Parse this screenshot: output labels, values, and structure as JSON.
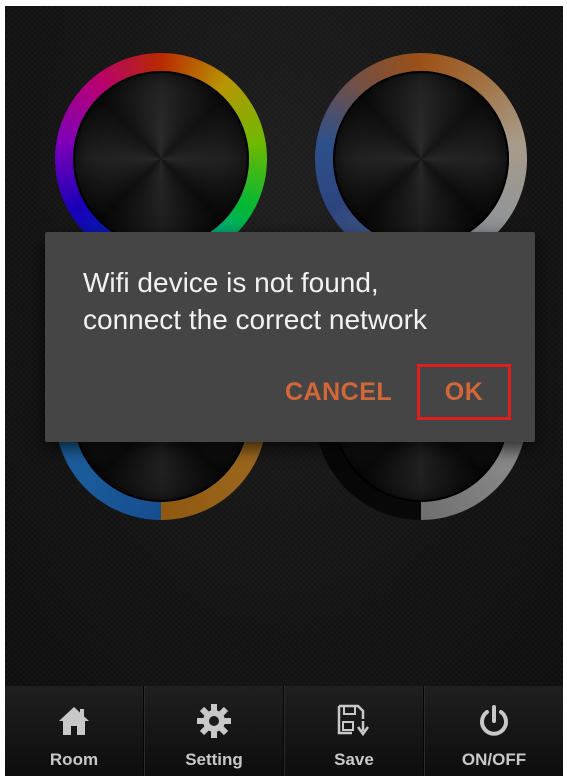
{
  "dialog": {
    "message_line1": "Wifi device is not found,",
    "message_line2": "connect the correct network",
    "cancel_label": "CANCEL",
    "ok_label": "OK"
  },
  "tabbar": {
    "items": [
      {
        "label": "Room",
        "icon": "home-icon"
      },
      {
        "label": "Setting",
        "icon": "gear-icon"
      },
      {
        "label": "Save",
        "icon": "save-icon"
      },
      {
        "label": "ON/OFF",
        "icon": "power-icon"
      }
    ]
  },
  "colors": {
    "accent": "#d4673a",
    "highlight": "#e02020",
    "dialog_bg": "#454545",
    "screen_bg": "#161616"
  }
}
